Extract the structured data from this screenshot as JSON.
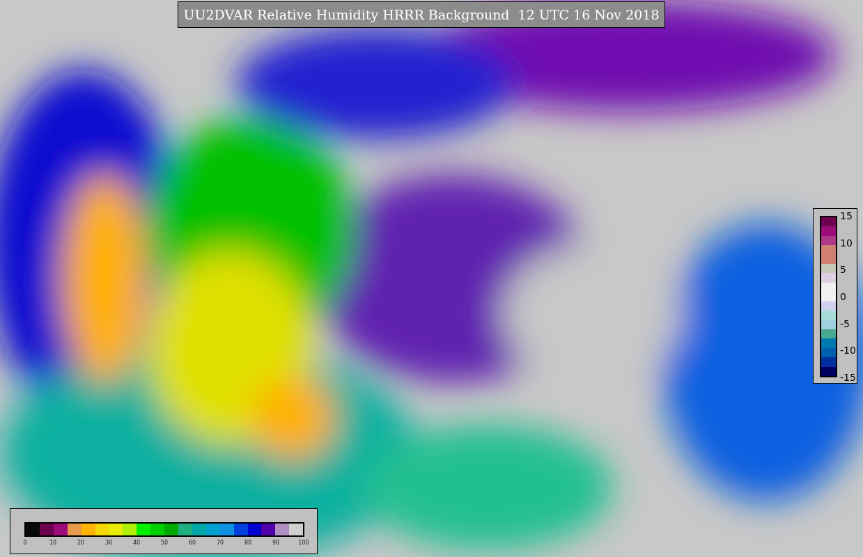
{
  "title": "UU2DVAR Relative Humidity HRRR Background  12 UTC 16 Nov 2018",
  "difference_colorbar": {
    "ticks": [
      "15",
      "10",
      "5",
      "0",
      "-5",
      "-10",
      "-15"
    ],
    "bins": [
      {
        "color": "#6e0050"
      },
      {
        "color": "#9c0c78"
      },
      {
        "color": "#b03888"
      },
      {
        "color": "#d08070"
      },
      {
        "color": "#d08070"
      },
      {
        "color": "#c8c8b8"
      },
      {
        "color": "#dcd0e0"
      },
      {
        "color": "#f0f0f0"
      },
      {
        "color": "#f0f0f0"
      },
      {
        "color": "#d0d0f0"
      },
      {
        "color": "#a8dcd8"
      },
      {
        "color": "#a0d0e0"
      },
      {
        "color": "#48a890"
      },
      {
        "color": "#0078b0"
      },
      {
        "color": "#0060b0"
      },
      {
        "color": "#0030a0"
      },
      {
        "color": "#000060"
      }
    ]
  },
  "humidity_colorbar": {
    "ticks": [
      "0",
      "10",
      "20",
      "30",
      "40",
      "50",
      "60",
      "70",
      "80",
      "90",
      "100"
    ],
    "bins": [
      {
        "color": "#0a0a0a"
      },
      {
        "color": "#6e0050"
      },
      {
        "color": "#9c0c78"
      },
      {
        "color": "#e89a4c"
      },
      {
        "color": "#ffb400"
      },
      {
        "color": "#f5d800"
      },
      {
        "color": "#e8ec00"
      },
      {
        "color": "#b0f000"
      },
      {
        "color": "#00f000"
      },
      {
        "color": "#00d000"
      },
      {
        "color": "#00a800"
      },
      {
        "color": "#20b080"
      },
      {
        "color": "#00a8a8"
      },
      {
        "color": "#00a0d0"
      },
      {
        "color": "#1090e0"
      },
      {
        "color": "#0040e0"
      },
      {
        "color": "#0000d0"
      },
      {
        "color": "#5000a8"
      },
      {
        "color": "#b090c0"
      },
      {
        "color": "#d0d0d0"
      }
    ]
  }
}
